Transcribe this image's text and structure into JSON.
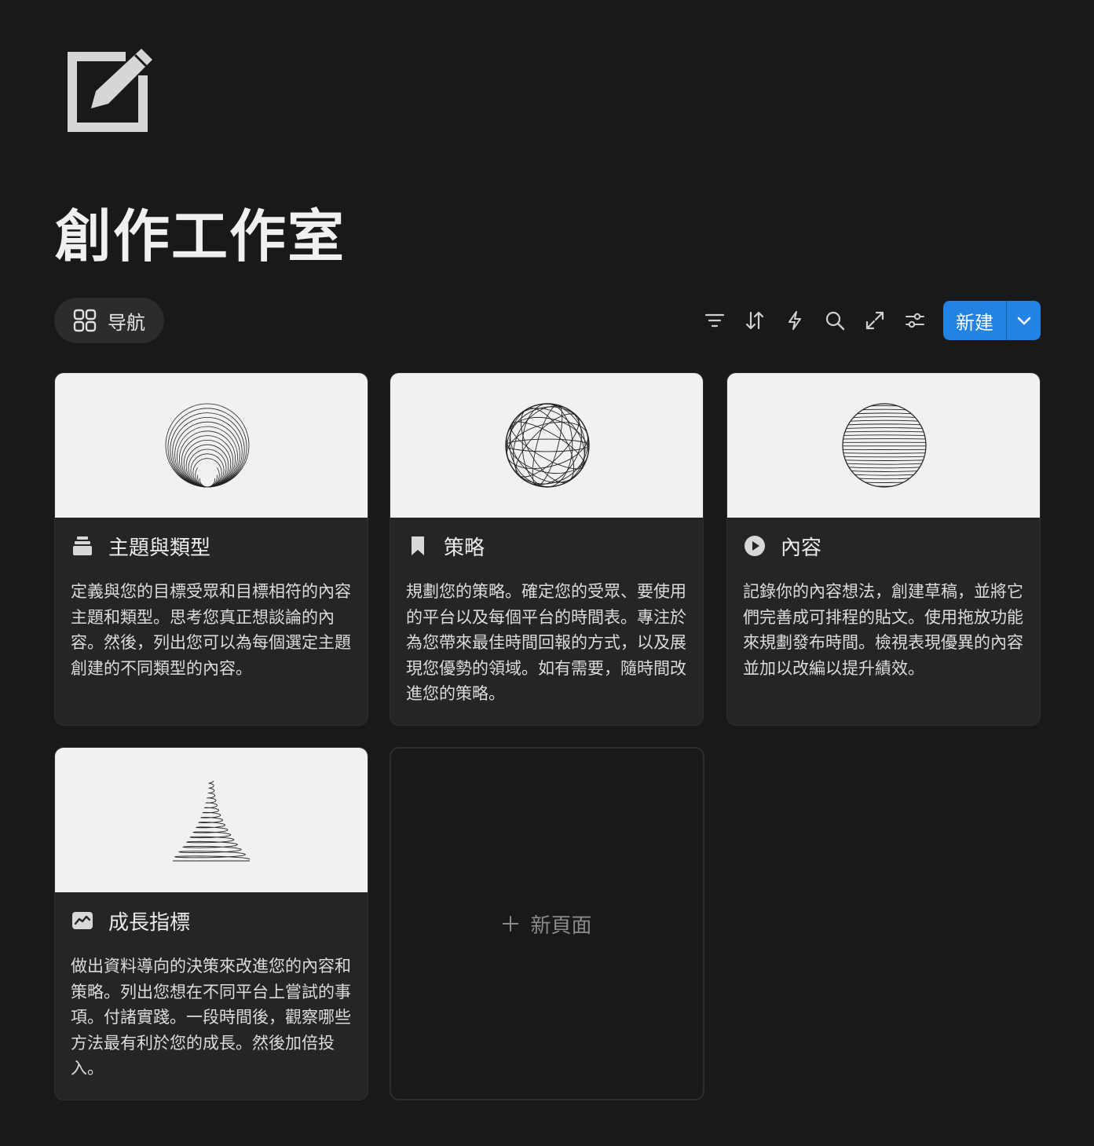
{
  "page": {
    "title": "創作工作室",
    "icon": "edit-square-icon"
  },
  "toolbar": {
    "nav_tab": {
      "label": "导航",
      "icon": "grid-icon"
    },
    "icons": [
      "filter-icon",
      "sort-icon",
      "lightning-icon",
      "search-icon",
      "expand-icon",
      "settings-sliders-icon"
    ],
    "new_button": {
      "label": "新建",
      "dropdown_icon": "chevron-down-icon"
    },
    "accent_color": "#2383e2"
  },
  "cards": [
    {
      "title": "主題與類型",
      "icon": "stack-icon",
      "description": "定義與您的目標受眾和目標相符的內容主題和類型。思考您真正想談論的內容。然後，列出您可以為每個選定主題創建的不同類型的內容。",
      "cover": "concentric-circles-art"
    },
    {
      "title": "策略",
      "icon": "bookmark-icon",
      "description": "規劃您的策略。確定您的受眾、要使用的平台以及每個平台的時間表。專注於為您帶來最佳時間回報的方式，以及展現您優勢的領域。如有需要，隨時間改進您的策略。",
      "cover": "geodesic-sphere-art"
    },
    {
      "title": "內容",
      "icon": "play-circle-icon",
      "description": "記錄你的內容想法，創建草稿，並將它們完善成可排程的貼文。使用拖放功能來規劃發布時間。檢視表現優異的內容並加以改編以提升績效。",
      "cover": "striped-sphere-art"
    },
    {
      "title": "成長指標",
      "icon": "chart-line-icon",
      "description": "做出資料導向的決策來改進您的內容和策略。列出您想在不同平台上嘗試的事項。付諸實踐。一段時間後，觀察哪些方法最有利於您的成長。然後加倍投入。",
      "cover": "spiral-cone-art"
    }
  ],
  "new_page": {
    "label": "新頁面",
    "icon": "plus-icon"
  }
}
